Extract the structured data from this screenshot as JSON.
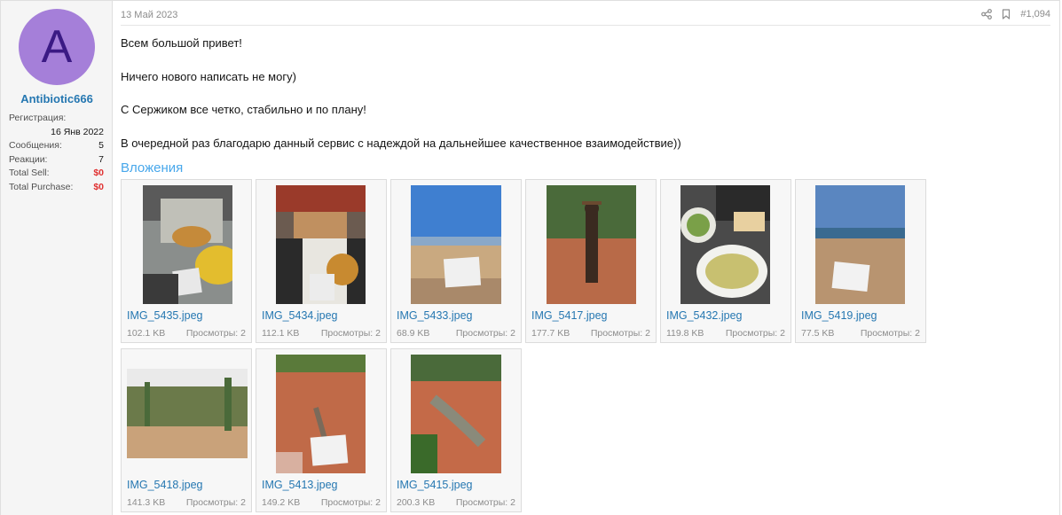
{
  "user": {
    "avatar_letter": "A",
    "avatar_color": "#a57fd9",
    "name": "Antibiotic666",
    "reg_label": "Регистрация:",
    "reg_value": "16 Янв 2022",
    "messages_label": "Сообщения:",
    "messages_value": "5",
    "reactions_label": "Реакции:",
    "reactions_value": "7",
    "sell_label": "Total Sell:",
    "sell_value": "$0",
    "purchase_label": "Total Purchase:",
    "purchase_value": "$0"
  },
  "post": {
    "date": "13 Май 2023",
    "number": "#1,094",
    "icons": [
      "share-icon",
      "bookmark-icon"
    ],
    "lines": [
      "Всем большой привет!",
      "Ничего нового написать не могу)",
      "С Сержиком все четко, стабильно и по плану!",
      "В очередной раз благодарю данный сервис с надеждой на дальнейшее качественное взаимодействие))"
    ],
    "attachments_title": "Вложения",
    "views_label": "Просмотры:",
    "attachments": [
      {
        "name": "IMG_5435.jpeg",
        "size": "102.1 KB",
        "views": "2"
      },
      {
        "name": "IMG_5434.jpeg",
        "size": "112.1 KB",
        "views": "2"
      },
      {
        "name": "IMG_5433.jpeg",
        "size": "68.9 KB",
        "views": "2"
      },
      {
        "name": "IMG_5417.jpeg",
        "size": "177.7 KB",
        "views": "2"
      },
      {
        "name": "IMG_5432.jpeg",
        "size": "119.8 KB",
        "views": "2"
      },
      {
        "name": "IMG_5419.jpeg",
        "size": "77.5 KB",
        "views": "2"
      },
      {
        "name": "IMG_5418.jpeg",
        "size": "141.3 KB",
        "views": "2"
      },
      {
        "name": "IMG_5413.jpeg",
        "size": "149.2 KB",
        "views": "2"
      },
      {
        "name": "IMG_5415.jpeg",
        "size": "200.3 KB",
        "views": "2"
      }
    ]
  }
}
